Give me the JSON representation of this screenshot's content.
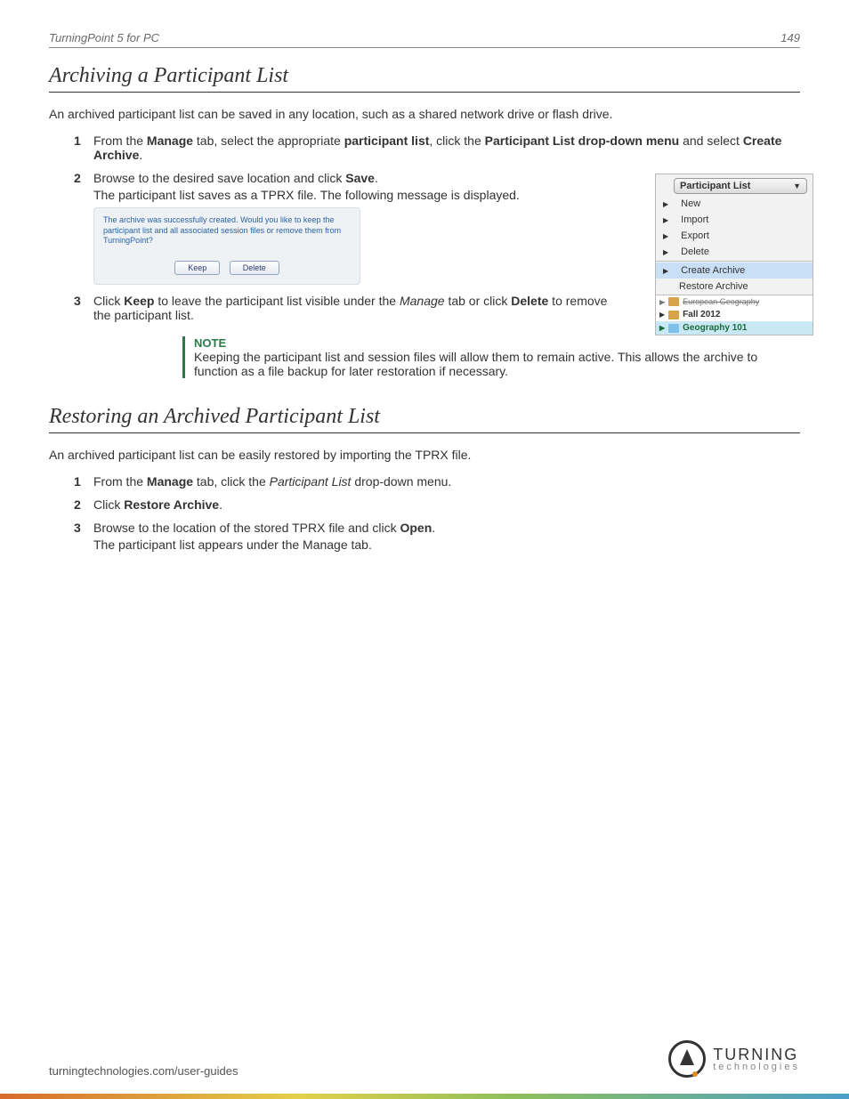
{
  "header": {
    "doc_title": "TurningPoint 5 for PC",
    "page_number": "149"
  },
  "section1": {
    "title": "Archiving a Participant List",
    "intro": "An archived participant list can be saved in any location, such as a shared network drive or flash drive.",
    "steps": [
      {
        "num": "1",
        "pre": "From the ",
        "b1": "Manage",
        "mid1": " tab, select the appropriate ",
        "b2": "participant list",
        "mid2": ", click the ",
        "b3": "Participant List drop-down menu",
        "mid3": " and select ",
        "b4": "Create Archive",
        "end": "."
      },
      {
        "num": "2",
        "pre": "Browse to the desired save location and click ",
        "b1": "Save",
        "end": ".",
        "sub": "The participant list saves as a TPRX file. The following message is displayed."
      },
      {
        "num": "3",
        "pre": "Click ",
        "b1": "Keep",
        "mid1": " to leave the participant list visible under the ",
        "i1": "Manage",
        "mid2": " tab or click ",
        "b2": "Delete",
        "mid3": " to remove the participant list.",
        "end": ""
      }
    ],
    "dialog": {
      "msg": "The archive was successfully created. Would you like to keep the participant list and all associated session files or remove them from TurningPoint?",
      "keep": "Keep",
      "delete": "Delete"
    },
    "note": {
      "label": "NOTE",
      "text": "Keeping the participant list and session files will allow them to remain active. This allows the archive to function as a file backup for later restoration if necessary."
    }
  },
  "dropdown": {
    "header": "Participant List",
    "items": [
      "New",
      "Import",
      "Export",
      "Delete"
    ],
    "archive_items": [
      "Create Archive",
      "Restore Archive"
    ],
    "tree_struck": "European Geography",
    "tree1": "Fall 2012",
    "tree2": "Geography 101"
  },
  "section2": {
    "title": "Restoring an Archived Participant List",
    "intro": "An archived participant list can be easily restored by importing the TPRX file.",
    "steps": [
      {
        "num": "1",
        "pre": "From the ",
        "b1": "Manage",
        "mid1": " tab, click the ",
        "i1": "Participant List",
        "end": " drop-down menu."
      },
      {
        "num": "2",
        "pre": "Click ",
        "b1": "Restore Archive",
        "end": "."
      },
      {
        "num": "3",
        "pre": "Browse to the location of the stored TPRX file and click ",
        "b1": "Open",
        "end": ".",
        "sub": "The participant list appears under the Manage tab."
      }
    ]
  },
  "footer": {
    "url": "turningtechnologies.com/user-guides",
    "logo_big": "TURNING",
    "logo_small": "technologies"
  }
}
